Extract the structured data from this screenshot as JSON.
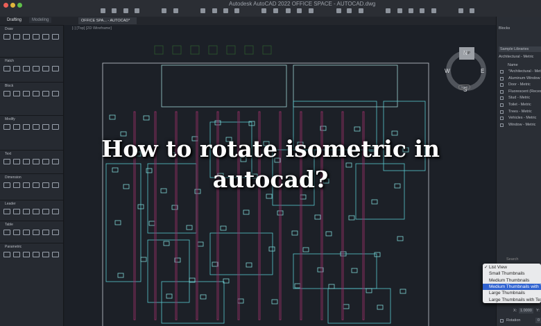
{
  "window": {
    "title": "Autodesk AutoCAD 2022   OFFICE SPACE - AUTOCAD.dwg"
  },
  "palette_tabs": [
    "Drafting",
    "Modeling"
  ],
  "document_tab": "OFFICE SPA... - AUTOCAD*",
  "viewport_label": "[-] [Top] [2D Wireframe]",
  "palette_sections": [
    "Draw",
    "Hatch",
    "Block",
    "Modify",
    "Text",
    "Dimension",
    "Leader",
    "Table",
    "Parametric"
  ],
  "viewcube": {
    "top": "TOP",
    "n": "N",
    "s": "S",
    "e": "E",
    "w": "W",
    "wcs": "WCS"
  },
  "blocks_panel": {
    "title": "Blocks",
    "library": "Sample Libraries",
    "folder": "Architectural - Metric",
    "column": "Name",
    "items": [
      "*Architectural - Metric",
      "Aluminum Window",
      "Door - Metric",
      "Fluorescent (Recessed)",
      "Stud - Metric",
      "Toilet - Metric",
      "Trees - Metric",
      "Vehicles - Metric",
      "Window - Metric"
    ],
    "search_placeholder": "Search",
    "x_label": "X:",
    "x_value": "1.0000",
    "y_label": "Y:",
    "rotation_label": "Rotation",
    "rotation_value": "0"
  },
  "view_menu": {
    "items": [
      "List View",
      "Small Thumbnails",
      "Medium Thumbnails",
      "Medium Thumbnails with Text",
      "Large Thumbnails",
      "Large Thumbnails with Text"
    ],
    "checked": 0,
    "highlighted": 3
  },
  "headline": [
    "How to rotate isometric in",
    "autocad?"
  ]
}
